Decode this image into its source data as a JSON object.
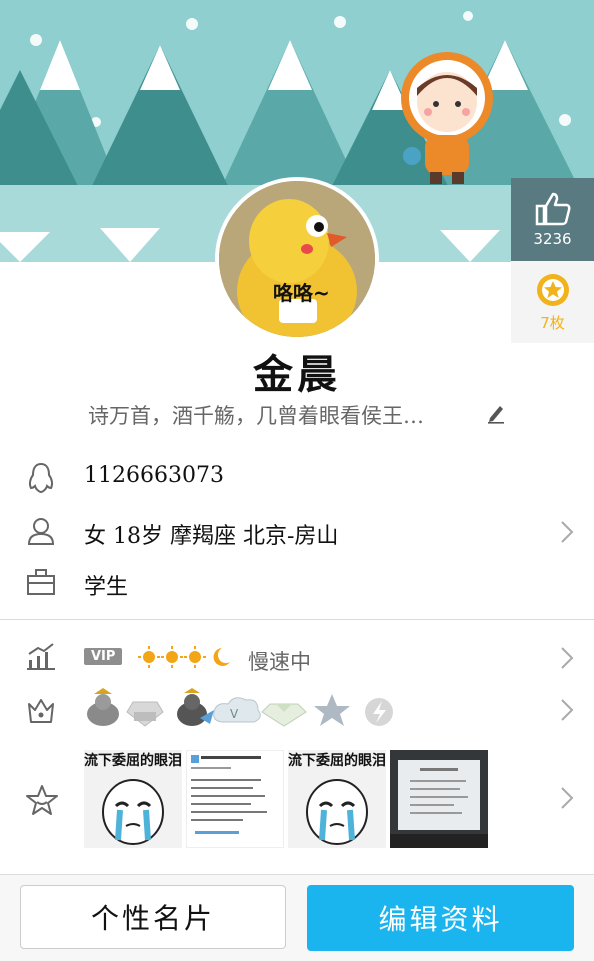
{
  "profile": {
    "name": "金晨",
    "signature": "诗万首，酒千觞，几曾着眼看侯王…",
    "avatar_caption": "咯咯~"
  },
  "stats": {
    "likes": "3236",
    "coins": "7枚"
  },
  "info": {
    "qq_number": "1126663073",
    "details": "女  18岁  摩羯座  北京-房山",
    "occupation": "学生"
  },
  "level": {
    "vip_label": "VIP",
    "status": "慢速中"
  },
  "photos": {
    "caption_1": "流下委屈的眼泪",
    "caption_3": "流下委屈的眼泪"
  },
  "buttons": {
    "card": "个性名片",
    "edit": "编辑资料"
  },
  "colors": {
    "banner_sky": "#8fcfcf",
    "tree": "#3f8e8e",
    "like_panel": "#597a80",
    "accent_blue": "#1ab5ee",
    "coin_yellow": "#f2b21c"
  }
}
